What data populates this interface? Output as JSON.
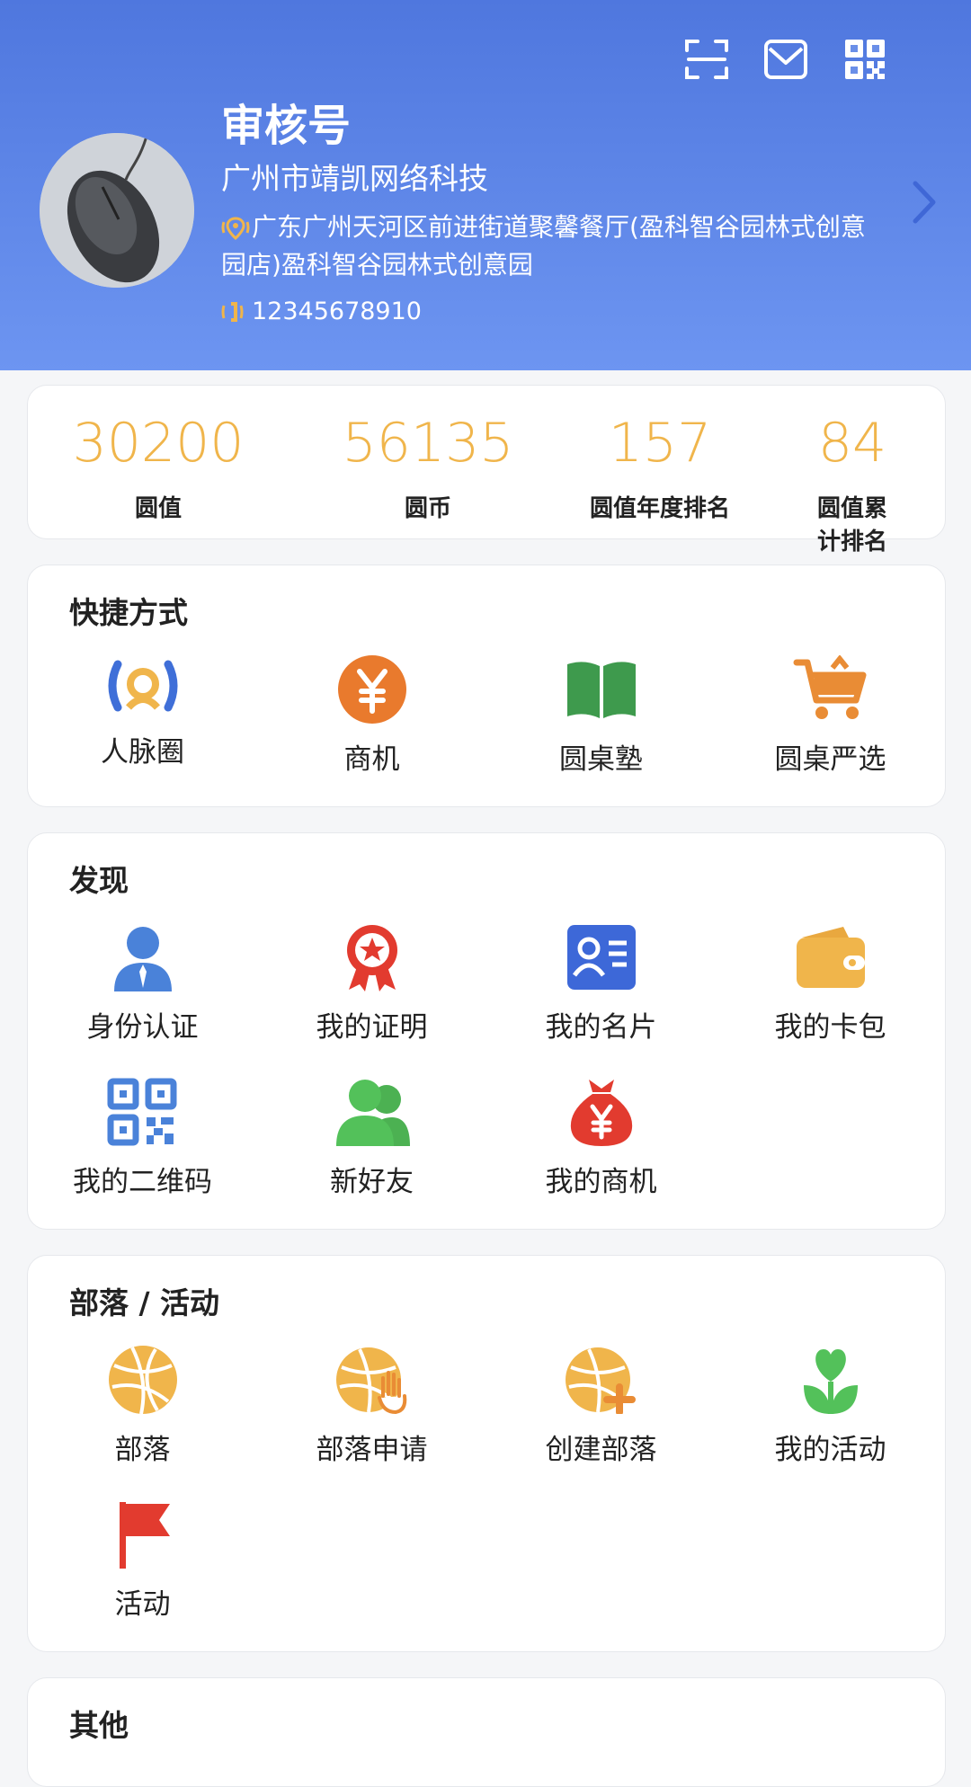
{
  "profile": {
    "name": "审核号",
    "company": "广州市靖凯网络科技",
    "address": "广东广州天河区前进街道聚馨餐厅(盈科智谷园林式创意园店)盈科智谷园林式创意园",
    "phone": "12345678910",
    "avatar_icon": "computer-mouse-photo"
  },
  "stats": [
    {
      "value": "30200",
      "label": "圆值"
    },
    {
      "value": "56135",
      "label": "圆币"
    },
    {
      "value": "157",
      "label": "圆值年度排名"
    },
    {
      "value": "84",
      "label": "圆值累计排名"
    }
  ],
  "shortcuts": {
    "title": "快捷方式",
    "items": [
      {
        "label": "人脉圈",
        "icon": "network-icon"
      },
      {
        "label": "商机",
        "icon": "yuan-coin-icon"
      },
      {
        "label": "圆桌塾",
        "icon": "book-icon"
      },
      {
        "label": "圆桌严选",
        "icon": "cart-icon"
      }
    ]
  },
  "discover": {
    "title": "发现",
    "items": [
      {
        "label": "身份认证",
        "icon": "person-icon"
      },
      {
        "label": "我的证明",
        "icon": "award-icon"
      },
      {
        "label": "我的名片",
        "icon": "business-card-icon"
      },
      {
        "label": "我的卡包",
        "icon": "wallet-icon"
      },
      {
        "label": "我的二维码",
        "icon": "qr-code-icon"
      },
      {
        "label": "新好友",
        "icon": "friends-icon"
      },
      {
        "label": "我的商机",
        "icon": "money-bag-icon"
      }
    ]
  },
  "tribe": {
    "title": "部落 / 活动",
    "items": [
      {
        "label": "部落",
        "icon": "basketball-icon"
      },
      {
        "label": "部落申请",
        "icon": "basketball-hand-icon"
      },
      {
        "label": "创建部落",
        "icon": "basketball-plus-icon"
      },
      {
        "label": "我的活动",
        "icon": "heart-plant-icon"
      },
      {
        "label": "活动",
        "icon": "flag-icon"
      }
    ]
  },
  "other": {
    "title": "其他"
  },
  "colors": {
    "header_top": "#4f77de",
    "header_bottom": "#6d95f1",
    "stat_value": "#f0b54b"
  }
}
